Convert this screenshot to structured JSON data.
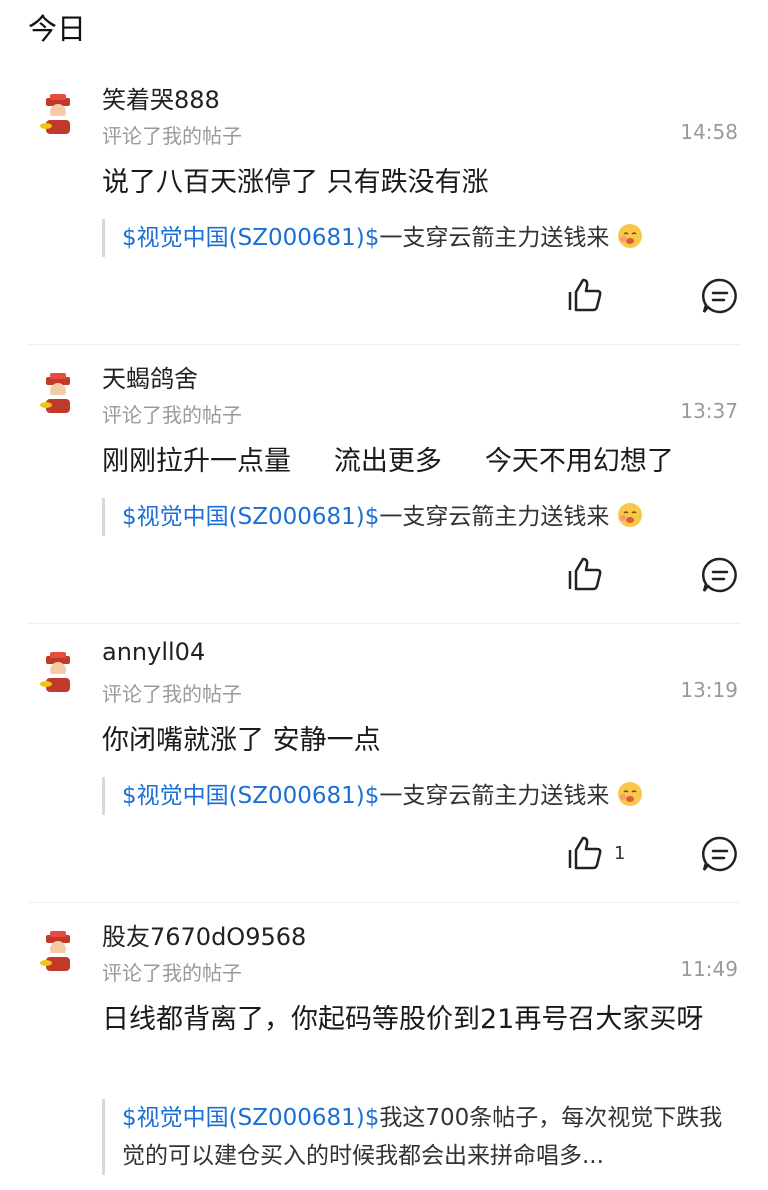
{
  "section_title": "今日",
  "action_text": "评论了我的帖子",
  "items": [
    {
      "username": "笑着哭888",
      "time": "14:58",
      "comment": "说了八百天涨停了 只有跌没有涨",
      "quote_stock": "$视觉中国(SZ000681)$",
      "quote_text": "一支穿云箭主力送钱来",
      "like_count": ""
    },
    {
      "username": "天蝎鸽舍",
      "time": "13:37",
      "comment": "刚刚拉升一点量     流出更多     今天不用幻想了",
      "quote_stock": "$视觉中国(SZ000681)$",
      "quote_text": "一支穿云箭主力送钱来",
      "like_count": ""
    },
    {
      "username": "annyll04",
      "time": "13:19",
      "comment": "你闭嘴就涨了 安静一点",
      "quote_stock": "$视觉中国(SZ000681)$",
      "quote_text": "一支穿云箭主力送钱来",
      "like_count": "1"
    },
    {
      "username": "股友7670dO9568",
      "time": "11:49",
      "comment": "日线都背离了，你起码等股价到21再号召大家买呀",
      "quote_stock": "$视觉中国(SZ000681)$",
      "quote_text": "我这700条帖子，每次视觉下跌我觉的可以建仓买入的时候我都会出来拼命唱多...",
      "like_count": ""
    }
  ]
}
